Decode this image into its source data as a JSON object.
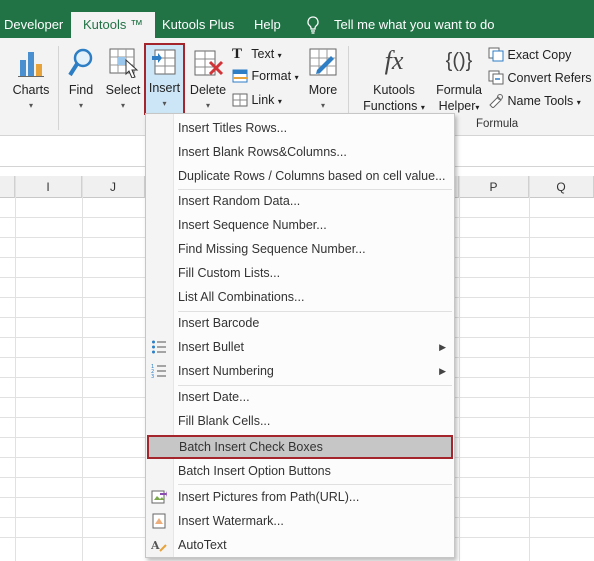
{
  "tabs": {
    "developer": "Developer",
    "kutools": "Kutools ™",
    "kutools_plus": "Kutools Plus",
    "help": "Help",
    "tell_me": "Tell me what you want to do"
  },
  "ribbon": {
    "charts": "Charts",
    "find": "Find",
    "select": "Select",
    "insert": "Insert",
    "delete": "Delete",
    "text": "Text",
    "format": "Format",
    "link": "Link",
    "more": "More",
    "kutools_functions_line1": "Kutools",
    "kutools_functions_line2": "Functions",
    "formula_helper_line1": "Formula",
    "formula_helper_line2": "Helper",
    "exact_copy": "Exact Copy",
    "convert_refers": "Convert Refers",
    "name_tools": "Name Tools",
    "group_formula": "Formula",
    "fx_glyph": "fx",
    "braces_glyph": "{()}"
  },
  "columns": [
    "I",
    "J",
    "P",
    "Q"
  ],
  "menu": {
    "items": [
      "Insert Titles Rows...",
      "Insert Blank Rows&Columns...",
      "Duplicate Rows / Columns based on cell value...",
      "Insert Random Data...",
      "Insert Sequence Number...",
      "Find Missing Sequence Number...",
      "Fill Custom Lists...",
      "List All Combinations...",
      "Insert Barcode",
      "Insert Bullet",
      "Insert Numbering",
      "Insert Date...",
      "Fill Blank Cells...",
      "Batch Insert Check Boxes",
      "Batch Insert Option Buttons",
      "Insert Pictures from Path(URL)...",
      "Insert Watermark...",
      "AutoText"
    ]
  },
  "colors": {
    "accent": "#217346",
    "highlight_border": "#a4262c",
    "highlight_bg": "#c6c6c6"
  },
  "icons": [
    "charts-icon",
    "find-icon",
    "select-icon",
    "insert-icon",
    "delete-icon",
    "text-icon",
    "format-icon",
    "link-icon",
    "more-icon",
    "fx-icon",
    "formula-helper-icon",
    "exact-copy-icon",
    "convert-refers-icon",
    "name-tools-icon",
    "bullet-icon",
    "numbering-icon",
    "picture-icon",
    "watermark-icon",
    "autotext-icon",
    "lightbulb-icon"
  ]
}
